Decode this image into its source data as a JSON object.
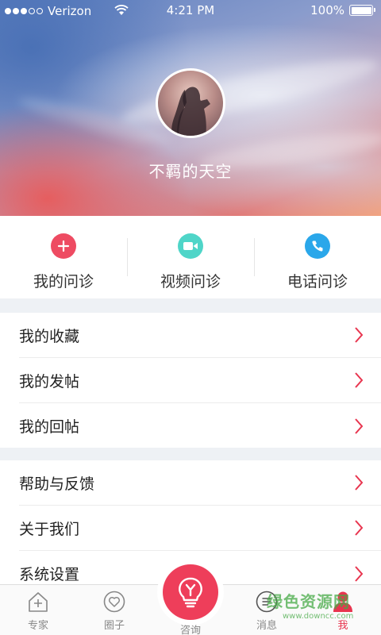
{
  "status_bar": {
    "carrier": "Verizon",
    "time": "4:21 PM",
    "battery": "100%"
  },
  "profile": {
    "username": "不羁的天空"
  },
  "consult": [
    {
      "label": "我的问诊",
      "icon": "plus-icon",
      "color": "#ee4b62"
    },
    {
      "label": "视频问诊",
      "icon": "video-camera-icon",
      "color": "#4fd5c8"
    },
    {
      "label": "电话问诊",
      "icon": "phone-icon",
      "color": "#2aa7ea"
    }
  ],
  "menu_group_1": [
    {
      "label": "我的收藏"
    },
    {
      "label": "我的发帖"
    },
    {
      "label": "我的回帖"
    }
  ],
  "menu_group_2": [
    {
      "label": "帮助与反馈"
    },
    {
      "label": "关于我们"
    },
    {
      "label": "系统设置"
    }
  ],
  "tabbar": [
    {
      "label": "专家",
      "icon": "house-plus-icon"
    },
    {
      "label": "圈子",
      "icon": "heart-chat-icon"
    },
    {
      "label": "咨询",
      "icon": "lightbulb-icon"
    },
    {
      "label": "消息",
      "icon": "message-icon"
    },
    {
      "label": "我",
      "icon": "user-icon",
      "active": true
    }
  ],
  "watermark": {
    "main": "绿色资源网",
    "sub": "www.downcc.com"
  },
  "colors": {
    "accent": "#ee3e5a",
    "chevron": "#e8354f"
  }
}
